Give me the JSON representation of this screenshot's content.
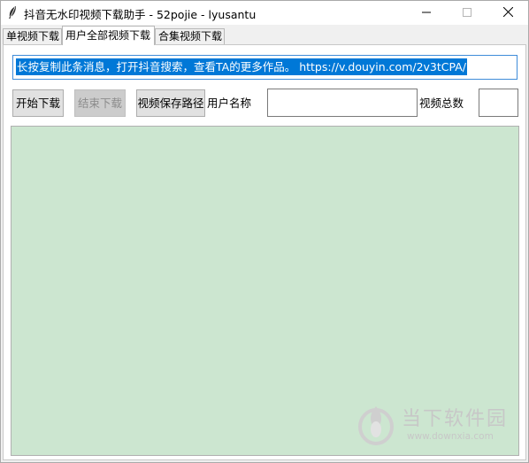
{
  "window": {
    "title": "抖音无水印视频下载助手 - 52pojie - lyusantu"
  },
  "tabs": [
    {
      "label": "单视频下载",
      "active": false
    },
    {
      "label": "用户全部视频下载",
      "active": true
    },
    {
      "label": "合集视频下载",
      "active": false
    }
  ],
  "share_input": {
    "value": "长按复制此条消息，打开抖音搜索，查看TA的更多作品。 https://v.douyin.com/2v3tCPA/"
  },
  "buttons": {
    "start": "开始下载",
    "stop": "结束下载",
    "save_path": "视频保存路径"
  },
  "labels": {
    "username": "用户名称",
    "video_total": "视频总数"
  },
  "fields": {
    "username_value": "",
    "video_total_value": ""
  },
  "watermark": {
    "name": "当下软件园",
    "url": "www.downxia.com"
  },
  "colors": {
    "log_background": "#cce6d0",
    "selection": "#0078d7",
    "input_focus_border": "#3f8cd9"
  }
}
